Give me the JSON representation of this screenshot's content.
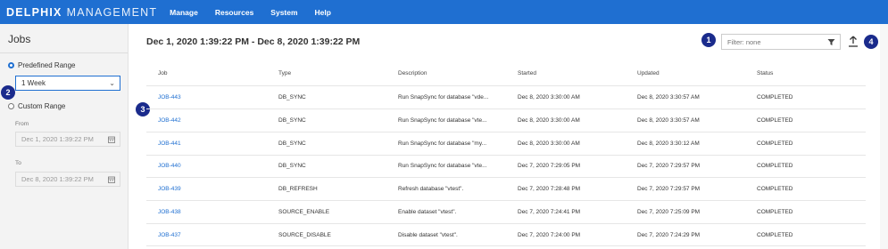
{
  "brand": {
    "name": "DELPHIX",
    "sub": "MANAGEMENT"
  },
  "nav": [
    "Manage",
    "Resources",
    "System",
    "Help"
  ],
  "sidebar": {
    "title": "Jobs",
    "predefined_label": "Predefined Range",
    "predefined_value": "1 Week",
    "custom_label": "Custom Range",
    "from_label": "From",
    "from_value": "Dec 1, 2020 1:39:22 PM",
    "to_label": "To",
    "to_value": "Dec 8, 2020 1:39:22 PM"
  },
  "main": {
    "range_title": "Dec 1, 2020 1:39:22 PM - Dec 8, 2020 1:39:22 PM",
    "filter_placeholder": "Filter: none"
  },
  "callouts": [
    "1",
    "2",
    "3",
    "4"
  ],
  "table": {
    "headers": [
      "Job",
      "Type",
      "Description",
      "Started",
      "Updated",
      "Status"
    ],
    "rows": [
      [
        "JOB-443",
        "DB_SYNC",
        "Run SnapSync for database \"vde...",
        "Dec 8, 2020 3:30:00 AM",
        "Dec 8, 2020 3:30:57 AM",
        "COMPLETED"
      ],
      [
        "JOB-442",
        "DB_SYNC",
        "Run SnapSync for database \"vte...",
        "Dec 8, 2020 3:30:00 AM",
        "Dec 8, 2020 3:30:57 AM",
        "COMPLETED"
      ],
      [
        "JOB-441",
        "DB_SYNC",
        "Run SnapSync for database \"my...",
        "Dec 8, 2020 3:30:00 AM",
        "Dec 8, 2020 3:30:12 AM",
        "COMPLETED"
      ],
      [
        "JOB-440",
        "DB_SYNC",
        "Run SnapSync for database \"vte...",
        "Dec 7, 2020 7:29:05 PM",
        "Dec 7, 2020 7:29:57 PM",
        "COMPLETED"
      ],
      [
        "JOB-439",
        "DB_REFRESH",
        "Refresh database \"vtest\".",
        "Dec 7, 2020 7:28:48 PM",
        "Dec 7, 2020 7:29:57 PM",
        "COMPLETED"
      ],
      [
        "JOB-438",
        "SOURCE_ENABLE",
        "Enable dataset \"vtest\".",
        "Dec 7, 2020 7:24:41 PM",
        "Dec 7, 2020 7:25:09 PM",
        "COMPLETED"
      ],
      [
        "JOB-437",
        "SOURCE_DISABLE",
        "Disable dataset \"vtest\".",
        "Dec 7, 2020 7:24:00 PM",
        "Dec 7, 2020 7:24:29 PM",
        "COMPLETED"
      ]
    ]
  }
}
